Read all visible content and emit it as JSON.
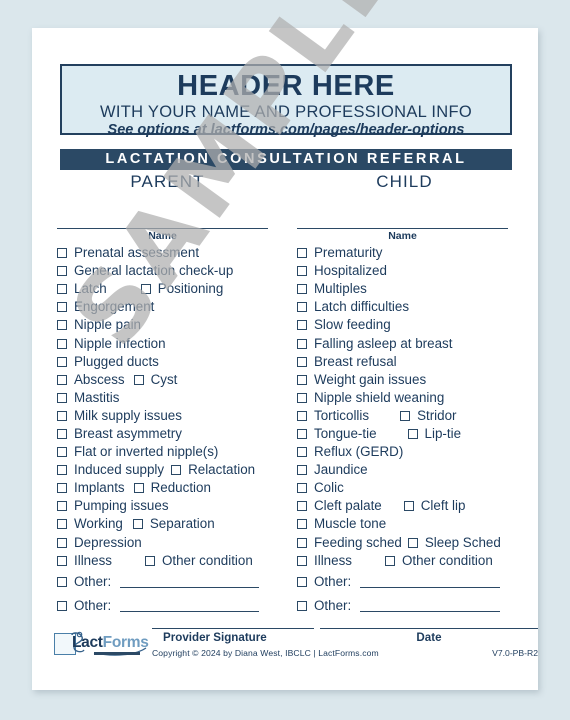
{
  "document": {
    "header": {
      "title": "HEADER HERE",
      "subtitle": "WITH YOUR NAME AND PROFESSIONAL INFO",
      "note": "See options at lactforms.com/pages/header-options"
    },
    "title_bar": "LACTATION CONSULTATION REFERRAL",
    "watermark": "SAMPLE",
    "colors": {
      "navy": "#2b4965",
      "text_navy": "#1d3b5c",
      "header_fill": "#dcebf2",
      "page_background": "#dbe7ec",
      "watermark_gray": "#b0b0b0"
    },
    "columns": [
      {
        "heading": "PARENT",
        "name_label": "Name",
        "items": [
          {
            "label": "Prenatal assessment"
          },
          {
            "label": "General lactation check-up"
          },
          {
            "label": "Latch",
            "label2": "Positioning",
            "gap": 34
          },
          {
            "label": "Engorgement"
          },
          {
            "label": "Nipple pain"
          },
          {
            "label": "Nipple infection"
          },
          {
            "label": "Plugged ducts"
          },
          {
            "label": "Abscess",
            "label2": "Cyst",
            "gap": 9
          },
          {
            "label": "Mastitis"
          },
          {
            "label": "Milk supply issues"
          },
          {
            "label": "Breast asymmetry"
          },
          {
            "label": "Flat or inverted nipple(s)"
          },
          {
            "label": "Induced supply",
            "label2": "Relactation",
            "gap": 7
          },
          {
            "label": "Implants",
            "label2": "Reduction",
            "gap": 9
          },
          {
            "label": "Pumping issues"
          },
          {
            "label": "Working",
            "label2": "Separation",
            "gap": 10
          },
          {
            "label": "Depression"
          },
          {
            "label": "Illness",
            "label2": "Other condition",
            "gap": 33
          }
        ],
        "other_rows": [
          {
            "label": "Other:"
          },
          {
            "label": "Other:"
          }
        ]
      },
      {
        "heading": "CHILD",
        "name_label": "Name",
        "items": [
          {
            "label": "Prematurity"
          },
          {
            "label": "Hospitalized"
          },
          {
            "label": "Multiples"
          },
          {
            "label": "Latch difficulties"
          },
          {
            "label": "Slow feeding"
          },
          {
            "label": "Falling asleep at breast"
          },
          {
            "label": "Breast refusal"
          },
          {
            "label": "Weight gain issues"
          },
          {
            "label": "Nipple shield weaning"
          },
          {
            "label": "Torticollis",
            "label2": "Stridor",
            "gap": 31
          },
          {
            "label": "Tongue-tie",
            "label2": "Lip-tie",
            "gap": 31
          },
          {
            "label": "Reflux (GERD)"
          },
          {
            "label": "Jaundice"
          },
          {
            "label": "Colic"
          },
          {
            "label": "Cleft palate",
            "label2": "Cleft lip",
            "gap": 22
          },
          {
            "label": "Muscle tone"
          },
          {
            "label": "Feeding sched",
            "label2": "Sleep Sched",
            "gap": 6
          },
          {
            "label": "Illness",
            "label2": "Other condition",
            "gap": 33
          }
        ],
        "other_rows": [
          {
            "label": "Other:"
          },
          {
            "label": "Other:"
          }
        ]
      }
    ],
    "footer": {
      "provider_signature_label": "Provider Signature",
      "date_label": "Date",
      "copyright": "Copyright © 2024 by Diana West, IBCLC  |  LactForms.com",
      "version": "V7.0-PB-R2",
      "logo": {
        "text_primary": "Lact",
        "text_secondary": "Forms"
      }
    }
  }
}
